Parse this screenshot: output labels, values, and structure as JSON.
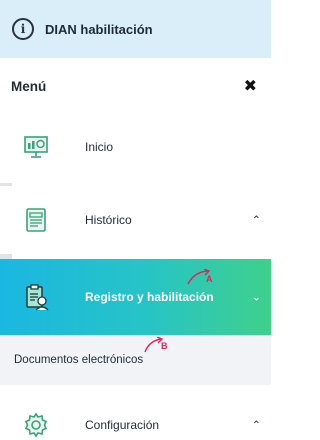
{
  "topbar": {
    "title": "DIAN habilitación",
    "icon": "info-icon"
  },
  "menu": {
    "title": "Menú",
    "close_glyph": "✖"
  },
  "items": [
    {
      "label": "Inicio",
      "icon": "dashboard-monitor-icon",
      "chevron": ""
    },
    {
      "label": "Histórico",
      "icon": "document-list-icon",
      "chevron": "⌃"
    },
    {
      "label": "Registro y habilitación",
      "icon": "clipboard-register-icon",
      "chevron": "⌄",
      "active": true
    },
    {
      "label": "Configuración",
      "icon": "gear-icon",
      "chevron": "⌃"
    }
  ],
  "subitems": [
    {
      "label": "Documentos electrónicos"
    }
  ],
  "annotations": {
    "a": "A",
    "b": "B"
  },
  "colors": {
    "topbar_bg": "#d9eef8",
    "active_gradient_start": "#1ab7e2",
    "active_gradient_end": "#3fd08c",
    "icon_green": "#3aa17a",
    "annotation": "#e02458"
  }
}
